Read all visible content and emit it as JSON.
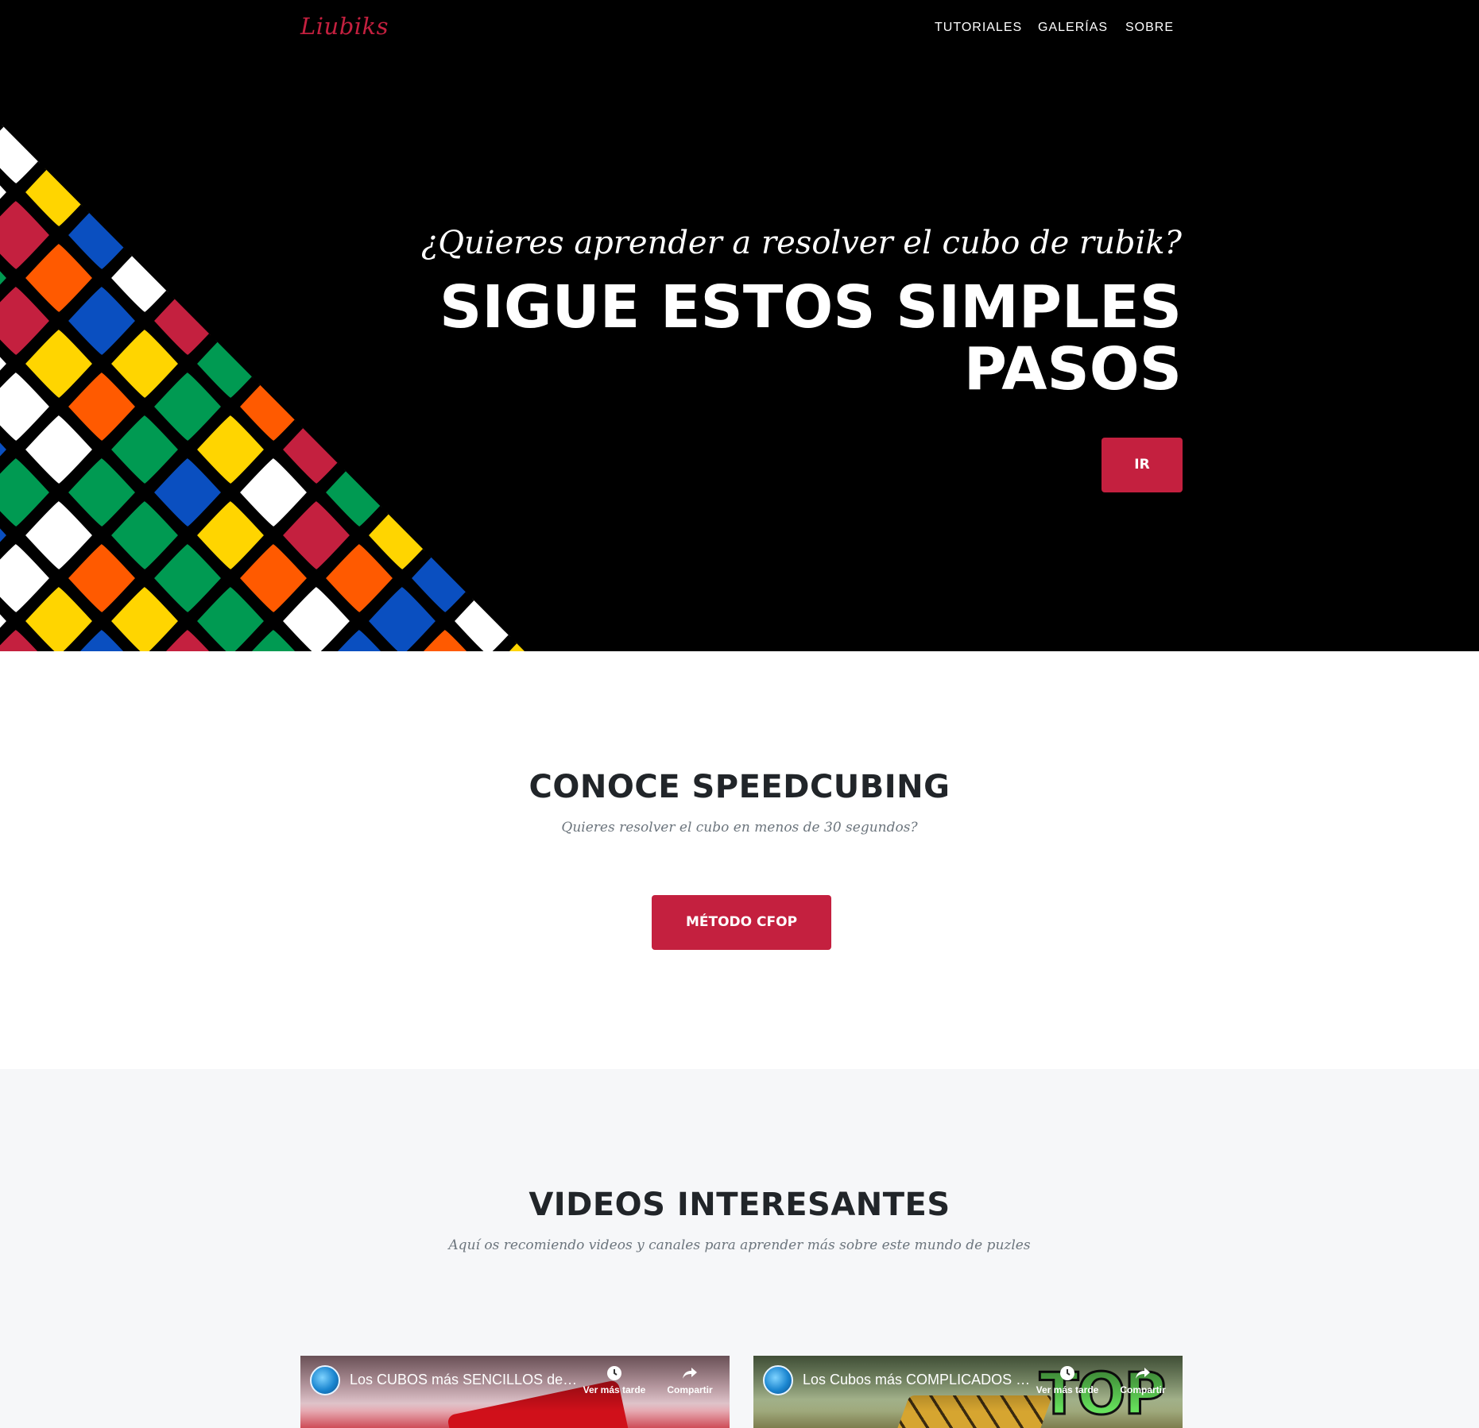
{
  "nav": {
    "brand": "Liubiks",
    "links": [
      "TUTORIALES",
      "GALERÍAS",
      "SOBRE"
    ]
  },
  "hero": {
    "subtitle": "¿Quieres aprender a resolver el cubo de rubik?",
    "title_line1": "SIGUE ESTOS SIMPLES",
    "title_line2": "PASOS",
    "button": "IR"
  },
  "speedcubing": {
    "heading": "CONOCE SPEEDCUBING",
    "subheading": "Quieres resolver el cubo en menos de 30 segundos?",
    "button": "MÉTODO CFOP"
  },
  "videos": {
    "heading": "VIDEOS INTERESANTES",
    "subheading": "Aquí os recomiendo videos y canales para aprender más sobre este mundo de puzles",
    "items": [
      {
        "title": "Los CUBOS más SENCILLOS del mundo",
        "watch_later": "Ver más tarde",
        "share": "Compartir"
      },
      {
        "title": "Los Cubos más COMPLICADOS del mundo",
        "watch_later": "Ver más tarde",
        "share": "Compartir",
        "badge": "TOP"
      }
    ]
  },
  "colors": {
    "accent": "#c4203f",
    "hero_bg": "#000000",
    "section_alt_bg": "#f6f7f9",
    "cube_red": "#c4203f",
    "cube_orange": "#ff5a00",
    "cube_blue": "#0a4fc0",
    "cube_green": "#009a52",
    "cube_yellow": "#ffd500",
    "cube_white": "#ffffff"
  }
}
